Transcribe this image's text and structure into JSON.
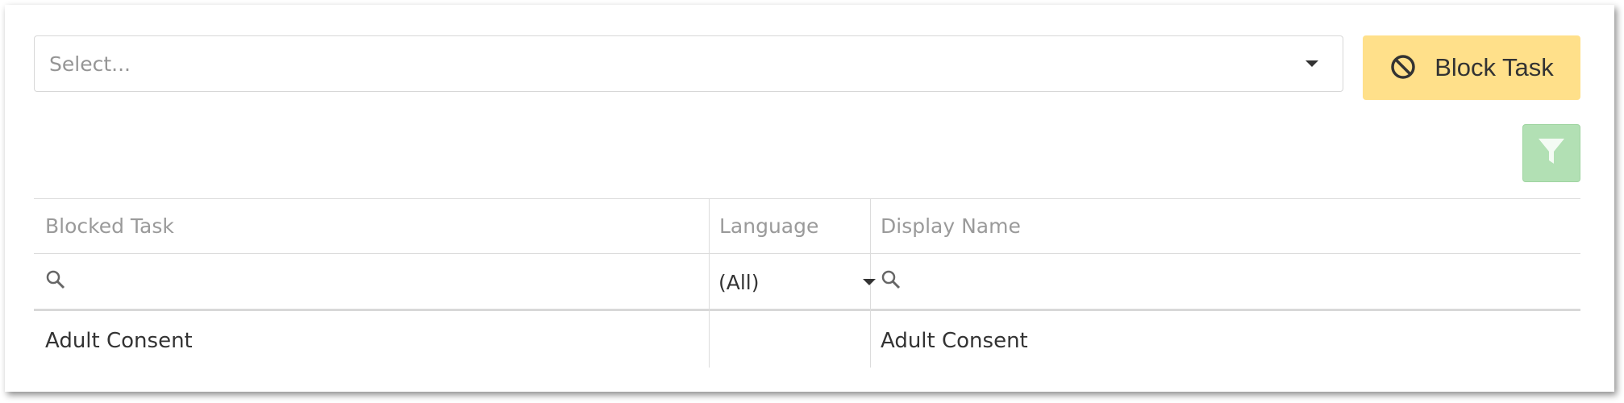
{
  "task_select": {
    "placeholder": "Select..."
  },
  "toolbar": {
    "block_label": "Block Task",
    "block_color": "#ffe08a",
    "filter_color": "#b2e0b4"
  },
  "icons": {
    "block": "block-icon",
    "filter": "filter-icon",
    "search": "search-icon"
  },
  "table": {
    "columns": [
      "Blocked Task",
      "Language",
      "Display Name"
    ],
    "filters": {
      "language": "(All)"
    },
    "rows": [
      {
        "blocked_task": "Adult Consent",
        "language": "",
        "display_name": "Adult Consent"
      }
    ]
  }
}
